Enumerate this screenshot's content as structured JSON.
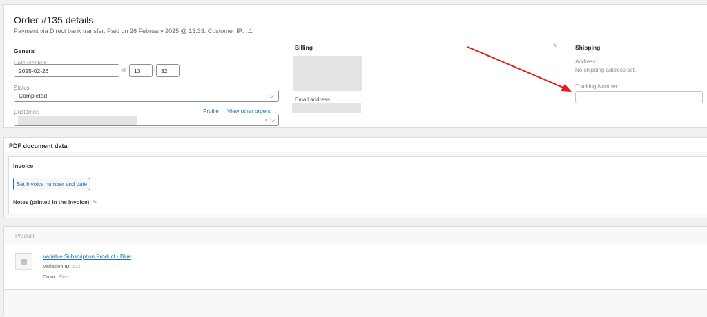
{
  "order": {
    "title": "Order #135 details",
    "subtitle": "Payment via Direct bank transfer. Paid on 26 February 2025 @ 13:33. Customer IP: ::1"
  },
  "general": {
    "heading": "General",
    "date_label": "Date created:",
    "date": "2025-02-26",
    "at": "@",
    "hour": "13",
    "colon": ":",
    "minute": "32",
    "status_label": "Status:",
    "status": "Completed",
    "customer_label": "Customer:",
    "profile_link": "Profile →",
    "orders_link": "View other orders →",
    "clear": "×"
  },
  "billing": {
    "heading": "Billing",
    "email_label": "Email address:"
  },
  "shipping": {
    "heading": "Shipping",
    "address_label": "Address:",
    "address": "No shipping address set.",
    "tracking_label": "Tracking Number:",
    "tracking_value": ""
  },
  "pdf": {
    "heading": "PDF document data",
    "invoice_heading": "Invoice",
    "set_button": "Set Invoice number and date",
    "notes_label": "Notes (printed in the invoice):"
  },
  "items": {
    "column": "Product",
    "product_name": "Variable Subscription Product - Blue",
    "variation_label": "Variation ID:",
    "variation_id": "132",
    "color_label": "Color:",
    "color": "Blue"
  },
  "annotation_color": "#e8191a"
}
